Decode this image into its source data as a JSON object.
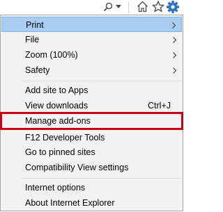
{
  "toolbar": {
    "icons": [
      "search-icon",
      "dropdown-arrow-icon",
      "home-icon",
      "favorites-star-icon",
      "settings-gear-icon"
    ]
  },
  "menu": {
    "items": [
      {
        "label": "Print",
        "submenu": true,
        "highlighted": true
      },
      {
        "label": "File",
        "submenu": true
      },
      {
        "label": "Zoom (100%)",
        "submenu": true
      },
      {
        "label": "Safety",
        "submenu": true
      },
      {
        "label": "Add site to Apps"
      },
      {
        "label": "View downloads",
        "shortcut": "Ctrl+J"
      },
      {
        "label": "Manage add-ons",
        "annotated": true
      },
      {
        "label": "F12 Developer Tools"
      },
      {
        "label": "Go to pinned sites"
      },
      {
        "label": "Compatibility View settings"
      },
      {
        "label": "Internet options"
      },
      {
        "label": "About Internet Explorer"
      }
    ]
  },
  "colors": {
    "highlight": "#a9cdf0",
    "annotation_box": "#c80013",
    "menu_background": "#f2f2f2"
  }
}
